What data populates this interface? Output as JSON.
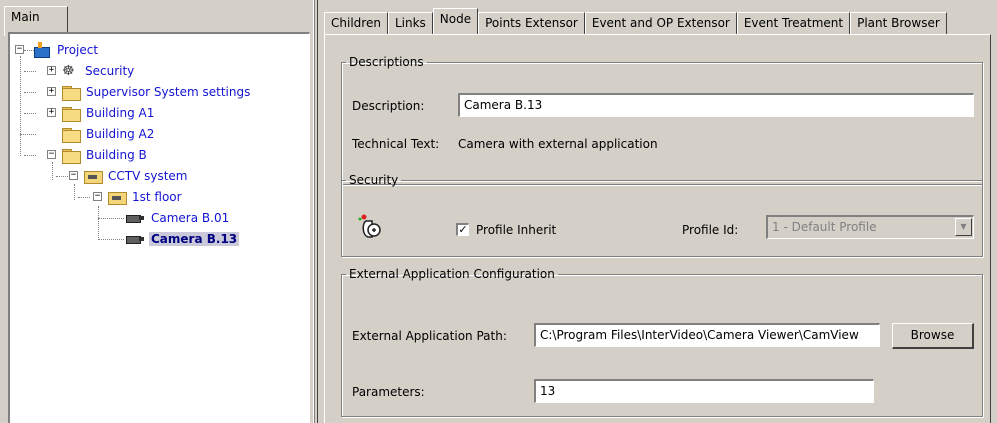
{
  "left_panel": {
    "tab_label": "Main",
    "tree": [
      {
        "label": "Project",
        "icon": "project-icon"
      },
      {
        "label": "Security",
        "icon": "security-icon"
      },
      {
        "label": "Supervisor System settings",
        "icon": "folder-icon"
      },
      {
        "label": "Building A1",
        "icon": "folder-icon"
      },
      {
        "label": "Building A2",
        "icon": "folder-icon"
      },
      {
        "label": "Building B",
        "icon": "folder-icon"
      },
      {
        "label": "CCTV system",
        "icon": "cctv-folder-icon"
      },
      {
        "label": "1st floor",
        "icon": "cctv-folder-icon"
      },
      {
        "label": "Camera B.01",
        "icon": "camera-icon"
      },
      {
        "label": "Camera B.13",
        "icon": "camera-icon",
        "selected": true
      }
    ]
  },
  "tabs": [
    "Children",
    "Links",
    "Node",
    "Points Extensor",
    "Event and OP Extensor",
    "Event Treatment",
    "Plant Browser"
  ],
  "active_tab": "Node",
  "descriptions": {
    "legend": "Descriptions",
    "description_label": "Description:",
    "description_value": "Camera B.13",
    "technical_label": "Technical Text:",
    "technical_value": "Camera with external application"
  },
  "security": {
    "legend": "Security",
    "profile_inherit_label": "Profile Inherit",
    "profile_inherit_checked": true,
    "profile_id_label": "Profile Id:",
    "profile_id_value": "1 - Default Profile"
  },
  "external_app": {
    "legend": "External Application Configuration",
    "path_label": "External Application Path:",
    "path_value": "C:\\Program Files\\InterVideo\\Camera Viewer\\CamView",
    "browse_label": "Browse",
    "params_label": "Parameters:",
    "params_value": "13"
  },
  "colors": {
    "tree_link": "#1414d4",
    "selection_bg": "#c9c9d9",
    "window_bg": "#d4d0c8"
  }
}
